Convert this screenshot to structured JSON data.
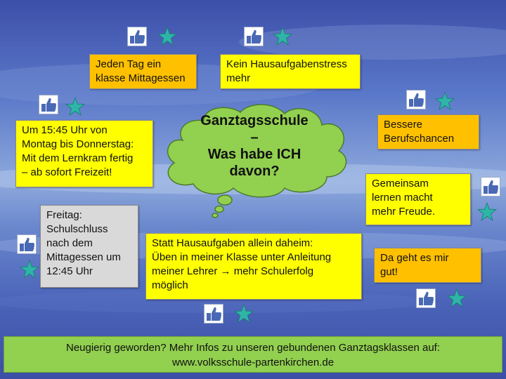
{
  "cloud": {
    "line1": "Ganztagsschule",
    "line2": "–",
    "line3": "Was habe ICH",
    "line4": "davon?"
  },
  "boxes": {
    "mittagessen": [
      "Jeden Tag ein",
      "klasse Mittagessen"
    ],
    "hausaufgabenstress": [
      "Kein Hausaufgabenstress",
      "mehr"
    ],
    "berufschancen": [
      "Bessere",
      "Berufschancen"
    ],
    "freizeit": [
      "Um 15:45 Uhr von",
      "Montag bis Donnerstag:",
      "Mit dem Lernkram fertig",
      "– ab sofort Freizeit!"
    ],
    "gemeinsam": [
      "Gemeinsam",
      "lernen macht",
      "mehr Freude."
    ],
    "freitag": [
      "Freitag:",
      "Schulschluss",
      "nach dem",
      "Mittagessen um",
      "12:45 Uhr"
    ],
    "daheim": [
      "Statt Hausaufgaben allein daheim:",
      "Üben in meiner Klasse unter Anleitung",
      "meiner Lehrer → mehr Schulerfolg",
      "möglich"
    ],
    "gutgehen": [
      "Da geht es mir",
      "gut!"
    ]
  },
  "footer": {
    "line1": "Neugierig geworden? Mehr Infos zu unseren gebundenen Ganztagsklassen auf:",
    "line2": "www.volksschule-partenkirchen.de"
  },
  "colors": {
    "yellow": "#ffff00",
    "orange": "#ffc000",
    "gray": "#d9d9d9",
    "green": "#92d050",
    "star": "#2eb5a8",
    "like": "#4a69b5"
  },
  "icons": [
    "thumbs-up-icon",
    "star-icon"
  ]
}
